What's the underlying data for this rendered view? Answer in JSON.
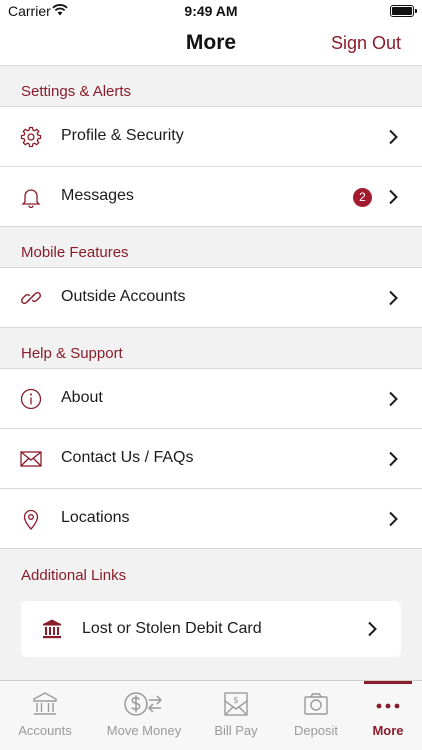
{
  "status_bar": {
    "carrier": "Carrier",
    "time": "9:49 AM"
  },
  "nav": {
    "title": "More",
    "sign_out": "Sign Out"
  },
  "colors": {
    "accent": "#8a1c2b",
    "badge": "#a11a2e",
    "tab_inactive": "#9a9a9a"
  },
  "sections": {
    "settings": {
      "title": "Settings & Alerts",
      "items": [
        {
          "label": "Profile & Security",
          "icon": "gear-icon"
        },
        {
          "label": "Messages",
          "icon": "bell-icon",
          "badge": "2"
        }
      ]
    },
    "mobile": {
      "title": "Mobile Features",
      "items": [
        {
          "label": "Outside Accounts",
          "icon": "link-icon"
        }
      ]
    },
    "help": {
      "title": "Help & Support",
      "items": [
        {
          "label": "About",
          "icon": "info-icon"
        },
        {
          "label": "Contact Us / FAQs",
          "icon": "envelope-icon"
        },
        {
          "label": "Locations",
          "icon": "location-pin-icon"
        }
      ]
    },
    "links": {
      "title": "Additional Links",
      "items": [
        {
          "label": "Lost or Stolen Debit Card",
          "icon": "bank-icon"
        }
      ]
    }
  },
  "tabs": [
    {
      "label": "Accounts",
      "icon": "bank-icon",
      "active": false
    },
    {
      "label": "Move Money",
      "icon": "transfer-money-icon",
      "active": false
    },
    {
      "label": "Bill Pay",
      "icon": "bill-icon",
      "active": false
    },
    {
      "label": "Deposit",
      "icon": "camera-icon",
      "active": false
    },
    {
      "label": "More",
      "icon": "more-dots-icon",
      "active": true
    }
  ]
}
